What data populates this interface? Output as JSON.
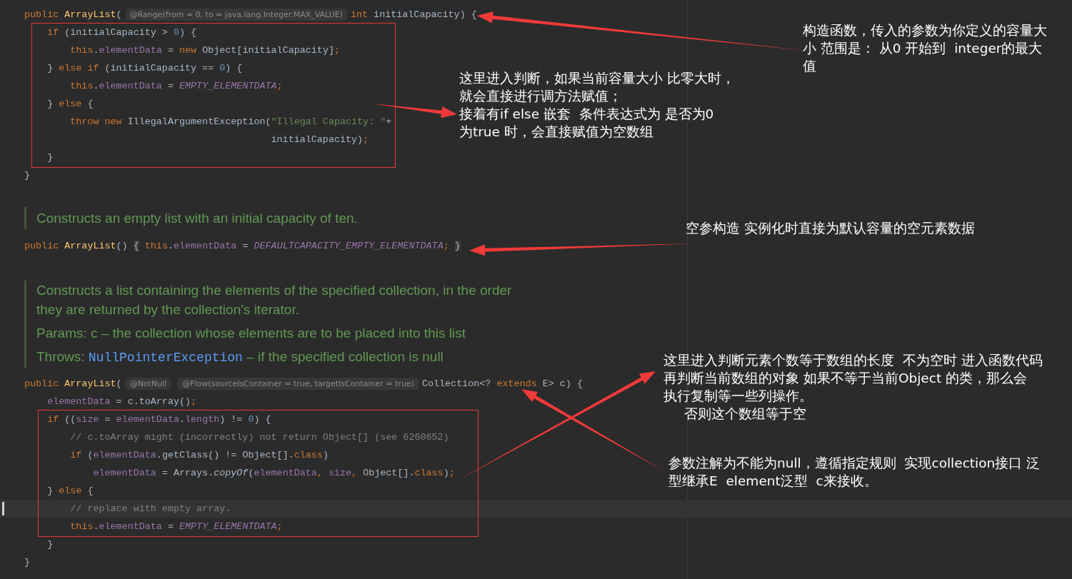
{
  "sections": [
    {
      "kind": "code",
      "lines": [
        {
          "current": false,
          "tokens": [
            {
              "kind": "kw",
              "t": "public"
            },
            {
              "kind": "fn",
              "t": " ArrayList"
            },
            {
              "kind": "plain",
              "t": "("
            },
            {
              "kind": "hint",
              "t": "@Range(from = 0, to = java.lang.Integer.MAX_VALUE)"
            },
            {
              "kind": "kw",
              "t": "int"
            },
            {
              "kind": "plain",
              "t": " initialCapacity) {"
            }
          ]
        },
        {
          "current": false,
          "tokens": [
            {
              "kind": "kw",
              "t": "    if"
            },
            {
              "kind": "plain",
              "t": " (initialCapacity > "
            },
            {
              "kind": "num",
              "t": "0"
            },
            {
              "kind": "plain",
              "t": ") {"
            }
          ]
        },
        {
          "current": false,
          "tokens": [
            {
              "kind": "kw",
              "t": "        this"
            },
            {
              "kind": "plain",
              "t": "."
            },
            {
              "kind": "field",
              "t": "elementData"
            },
            {
              "kind": "plain",
              "t": " = "
            },
            {
              "kind": "kw",
              "t": "new"
            },
            {
              "kind": "plain",
              "t": " Object[initialCapacity]"
            },
            {
              "kind": "kw",
              "t": ";"
            }
          ]
        },
        {
          "current": false,
          "tokens": [
            {
              "kind": "plain",
              "t": "    } "
            },
            {
              "kind": "kw",
              "t": "else if"
            },
            {
              "kind": "plain",
              "t": " (initialCapacity == "
            },
            {
              "kind": "num",
              "t": "0"
            },
            {
              "kind": "plain",
              "t": ") {"
            }
          ]
        },
        {
          "current": false,
          "tokens": [
            {
              "kind": "kw",
              "t": "        this"
            },
            {
              "kind": "plain",
              "t": "."
            },
            {
              "kind": "field",
              "t": "elementData"
            },
            {
              "kind": "plain",
              "t": " = "
            },
            {
              "kind": "const",
              "t": "EMPTY_ELEMENTDATA"
            },
            {
              "kind": "kw",
              "t": ";"
            }
          ]
        },
        {
          "current": false,
          "tokens": [
            {
              "kind": "plain",
              "t": "    } "
            },
            {
              "kind": "kw",
              "t": "else"
            },
            {
              "kind": "plain",
              "t": " {"
            }
          ]
        },
        {
          "current": false,
          "tokens": [
            {
              "kind": "kw",
              "t": "        throw new"
            },
            {
              "kind": "plain",
              "t": " IllegalArgumentException("
            },
            {
              "kind": "str",
              "t": "\"Illegal Capacity: \""
            },
            {
              "kind": "plain",
              "t": "+"
            }
          ]
        },
        {
          "current": false,
          "tokens": [
            {
              "kind": "plain",
              "t": "                                           initialCapacity)"
            },
            {
              "kind": "kw",
              "t": ";"
            }
          ]
        },
        {
          "current": false,
          "tokens": [
            {
              "kind": "plain",
              "t": "    }"
            }
          ]
        },
        {
          "current": false,
          "tokens": [
            {
              "kind": "plain",
              "t": "}"
            }
          ]
        }
      ]
    },
    {
      "kind": "doc",
      "paragraphs": [
        [
          [
            {
              "kind": "text",
              "t": "Constructs an empty list with an initial capacity of ten."
            }
          ]
        ]
      ]
    },
    {
      "kind": "code",
      "lines": [
        {
          "current": false,
          "tokens": [
            {
              "kind": "kw",
              "t": "public"
            },
            {
              "kind": "fn",
              "t": " ArrayList"
            },
            {
              "kind": "plain",
              "t": "() "
            },
            {
              "kind": "fold",
              "t": "{"
            },
            {
              "kind": "kw",
              "t": " this"
            },
            {
              "kind": "plain",
              "t": "."
            },
            {
              "kind": "field",
              "t": "elementData"
            },
            {
              "kind": "plain",
              "t": " = "
            },
            {
              "kind": "const",
              "t": "DEFAULTCAPACITY_EMPTY_ELEMENTDATA"
            },
            {
              "kind": "kw",
              "t": "; "
            },
            {
              "kind": "fold",
              "t": "}"
            }
          ]
        }
      ]
    },
    {
      "kind": "doc",
      "paragraphs": [
        [
          [
            {
              "kind": "text",
              "t": "Constructs a list containing the elements of the specified collection, in the order"
            }
          ],
          [
            {
              "kind": "text",
              "t": "they are returned by the collection's iterator."
            }
          ]
        ],
        [
          [
            {
              "kind": "text",
              "t": "Params: c – the collection whose elements are to be placed into this list"
            }
          ]
        ],
        [
          [
            {
              "kind": "text",
              "t": "Throws: "
            },
            {
              "kind": "link",
              "t": "NullPointerException"
            },
            {
              "kind": "text",
              "t": " – if the specified collection is null"
            }
          ]
        ]
      ]
    },
    {
      "kind": "code",
      "lines": [
        {
          "current": false,
          "tokens": [
            {
              "kind": "kw",
              "t": "public"
            },
            {
              "kind": "fn",
              "t": " ArrayList"
            },
            {
              "kind": "plain",
              "t": "("
            },
            {
              "kind": "hint",
              "t": "@NotNull"
            },
            {
              "kind": "hint",
              "t": "@Flow(sourceIsContainer = true, targetIsContainer = true)"
            },
            {
              "kind": "plain",
              "t": "Collection<? "
            },
            {
              "kind": "kw",
              "t": "extends"
            },
            {
              "kind": "plain",
              "t": " E> c) {"
            }
          ]
        },
        {
          "current": false,
          "tokens": [
            {
              "kind": "field",
              "t": "    elementData"
            },
            {
              "kind": "plain",
              "t": " = c.toArray()"
            },
            {
              "kind": "kw",
              "t": ";"
            }
          ]
        },
        {
          "current": false,
          "tokens": [
            {
              "kind": "kw",
              "t": "    if"
            },
            {
              "kind": "plain",
              "t": " (("
            },
            {
              "kind": "field",
              "t": "size"
            },
            {
              "kind": "plain",
              "t": " = "
            },
            {
              "kind": "field",
              "t": "elementData"
            },
            {
              "kind": "plain",
              "t": "."
            },
            {
              "kind": "field",
              "t": "length"
            },
            {
              "kind": "plain",
              "t": ") != "
            },
            {
              "kind": "num",
              "t": "0"
            },
            {
              "kind": "plain",
              "t": ") {"
            }
          ]
        },
        {
          "current": false,
          "tokens": [
            {
              "kind": "cmt",
              "t": "        // c.toArray might (incorrectly) not return Object[] (see 6260652)"
            }
          ]
        },
        {
          "current": false,
          "tokens": [
            {
              "kind": "kw",
              "t": "        if"
            },
            {
              "kind": "plain",
              "t": " ("
            },
            {
              "kind": "field",
              "t": "elementData"
            },
            {
              "kind": "plain",
              "t": ".getClass() != Object[]."
            },
            {
              "kind": "kw",
              "t": "class"
            },
            {
              "kind": "plain",
              "t": ")"
            }
          ]
        },
        {
          "current": false,
          "tokens": [
            {
              "kind": "field",
              "t": "            elementData"
            },
            {
              "kind": "plain",
              "t": " = Arrays."
            },
            {
              "kind": "italic",
              "t": "copyOf"
            },
            {
              "kind": "plain",
              "t": "("
            },
            {
              "kind": "field",
              "t": "elementData"
            },
            {
              "kind": "kw",
              "t": ", "
            },
            {
              "kind": "field",
              "t": "size"
            },
            {
              "kind": "kw",
              "t": ", "
            },
            {
              "kind": "plain",
              "t": "Object[]."
            },
            {
              "kind": "kw",
              "t": "class"
            },
            {
              "kind": "plain",
              "t": ")"
            },
            {
              "kind": "kw",
              "t": ";"
            }
          ]
        },
        {
          "current": false,
          "tokens": [
            {
              "kind": "plain",
              "t": "    } "
            },
            {
              "kind": "kw",
              "t": "else"
            },
            {
              "kind": "plain",
              "t": " {"
            }
          ]
        },
        {
          "current": true,
          "tokens": [
            {
              "kind": "cmt",
              "t": "        // replace with empty array."
            }
          ]
        },
        {
          "current": false,
          "tokens": [
            {
              "kind": "kw",
              "t": "        this"
            },
            {
              "kind": "plain",
              "t": "."
            },
            {
              "kind": "field",
              "t": "elementData"
            },
            {
              "kind": "plain",
              "t": " = "
            },
            {
              "kind": "const",
              "t": "EMPTY_ELEMENTDATA"
            },
            {
              "kind": "kw",
              "t": ";"
            }
          ]
        },
        {
          "current": false,
          "tokens": [
            {
              "kind": "plain",
              "t": "    }"
            }
          ]
        },
        {
          "current": false,
          "tokens": [
            {
              "kind": "plain",
              "t": "}"
            }
          ]
        }
      ]
    }
  ],
  "annotations": [
    {
      "lines": [
        "构造函数，传入的参数为你定义的容量大",
        "小 范围是： 从0 开始到  integer的最大",
        "值"
      ]
    },
    {
      "lines": [
        "这里进入判断，如果当前容量大小 比零大时，",
        "就会直接进行调方法赋值；",
        "接着有if else 嵌套  条件表达式为 是否为0",
        "为true 时，会直接赋值为空数组"
      ]
    },
    {
      "lines": [
        "空参构造 实例化时直接为默认容量的空元素数据"
      ]
    },
    {
      "lines": [
        "这里进入判断元素个数等于数组的长度  不为空时 进入函数代码",
        "再判断当前数组的对象 如果不等于当前Object 的类，那么会",
        "执行复制等一些列操作。",
        "     否则这个数组等于空"
      ]
    },
    {
      "lines": [
        "参数注解为不能为null，遵循指定规则  实现collection接口 泛",
        "型继承E  element泛型  c来接收。"
      ]
    }
  ]
}
